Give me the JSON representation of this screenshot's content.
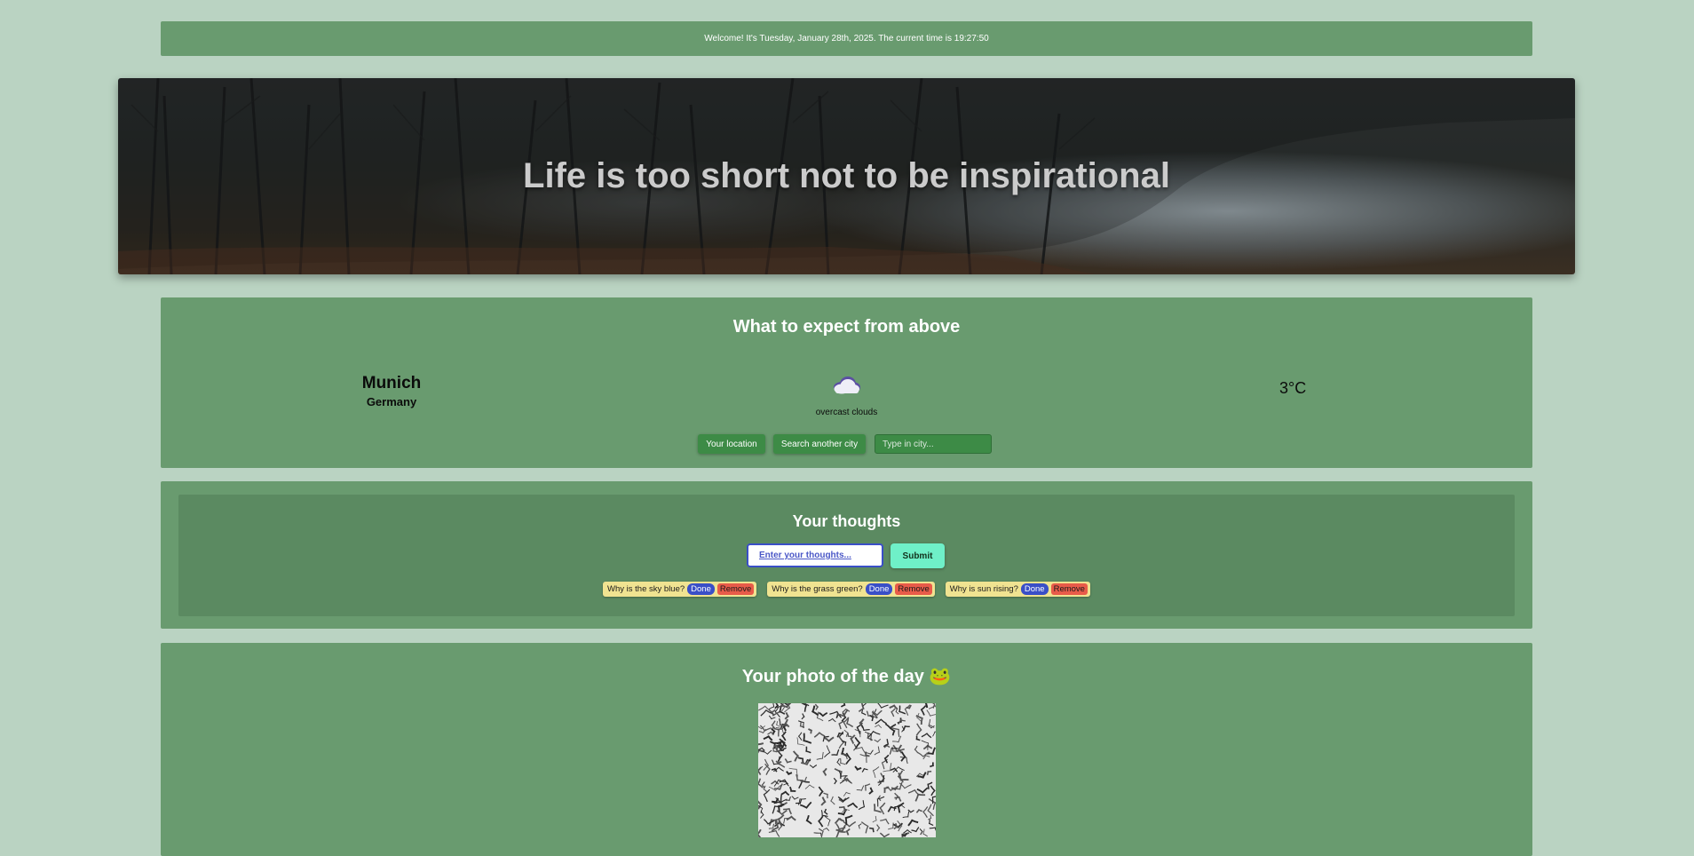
{
  "welcome": {
    "text": "Welcome! It's Tuesday, January 28th, 2025. The current time is 19:27:50"
  },
  "hero": {
    "title": "Life is too short not to be inspirational"
  },
  "weather": {
    "heading": "What to expect from above",
    "city": "Munich",
    "country": "Germany",
    "condition": "overcast clouds",
    "condition_icon": "cloud-icon",
    "temperature": "3°C",
    "location_button": "Your location",
    "search_button": "Search another city",
    "city_placeholder": "Type in city..."
  },
  "thoughts": {
    "heading": "Your thoughts",
    "input_placeholder": "Enter your thoughts...",
    "submit_label": "Submit",
    "done_label": "Done",
    "remove_label": "Remove",
    "items": [
      {
        "text": "Why is the sky blue?"
      },
      {
        "text": "Why is the grass green?"
      },
      {
        "text": "Why is sun rising?"
      }
    ]
  },
  "photo": {
    "heading": "Your photo of the day 🐸"
  },
  "colors": {
    "page_bg": "#bad3c2",
    "section_bg": "#699b6f",
    "button_green": "#3d8b46",
    "submit_bg": "#6ff0c8",
    "todo_bg": "#f0e391",
    "done_bg": "#3a4fc7",
    "remove_bg": "#e85b49"
  }
}
